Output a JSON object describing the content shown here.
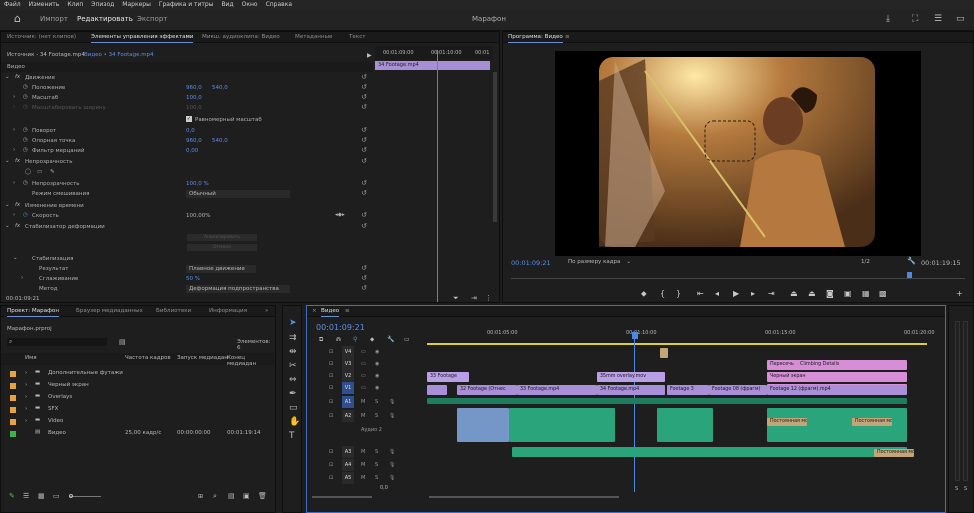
{
  "menu": [
    "Файл",
    "Изменить",
    "Клип",
    "Эпизод",
    "Маркеры",
    "Графика и титры",
    "Вид",
    "Окно",
    "Справка"
  ],
  "header": {
    "title": "Марафон",
    "import": "Импорт",
    "edit": "Редактировать",
    "export": "Экспорт"
  },
  "effect_controls": {
    "tabs": [
      "Источник: (нет клипов)",
      "Элементы управления эффектами",
      "Микш. аудиоклипа: Видео",
      "Метаданные",
      "Текст"
    ],
    "source": "Источник - 34 Footage.mp4",
    "sequence": "Видео • 34 Footage.mp4",
    "ruler": [
      "00:01:09:00",
      "00:01:10:00",
      "00:01"
    ],
    "clip_label": "34 Footage.mp4",
    "video_header": "Видео",
    "motion": "Движение",
    "position": "Положение",
    "position_x": "960,0",
    "position_y": "540,0",
    "scale": "Масштаб",
    "scale_v": "100,0",
    "scale_w": "Масштабировать ширину",
    "scale_w_v": "100,0",
    "uniform": "Равномерный масштаб",
    "rotation": "Поворот",
    "rotation_v": "0,0",
    "anchor": "Опорная точка",
    "anchor_x": "960,0",
    "anchor_y": "540,0",
    "flicker": "Фильтр мерцаний",
    "flicker_v": "0,00",
    "opacity": "Непрозрачность",
    "opacity_prop": "Непрозрачность",
    "opacity_v": "100,0 %",
    "blend": "Режим смешивания",
    "blend_v": "Обычный",
    "time_remap": "Изменение времени",
    "speed": "Скорость",
    "speed_v": "100,00%",
    "stabilizer": "Стабилизатор деформации",
    "btn1": "Анализировать",
    "btn2": "Отмена",
    "stabilization": "Стабилизация",
    "result": "Результат",
    "result_v": "Плавное движение",
    "smooth": "Сглаживание",
    "smooth_v": "50 %",
    "method": "Метод",
    "method_v": "Деформация подпространства",
    "timecode": "00:01:09:21"
  },
  "program": {
    "title": "Программа: Видео",
    "timecode": "00:01:09:21",
    "fit": "По размеру кадра",
    "ratio": "1/2",
    "duration": "00:01:19:15"
  },
  "project": {
    "tabs": [
      "Проект: Марафон",
      "Браузер медиаданных",
      "Библиотеки",
      "Информация"
    ],
    "file": "Марафон.prproj",
    "count": "Элементов: 6",
    "columns": [
      "Имя",
      "Частота кадров",
      "Запуск медиадан",
      "Конец медиадан"
    ],
    "items": [
      {
        "name": "Дополнительные футажи",
        "color": "#e8a23c",
        "fr": "",
        "start": "",
        "end": ""
      },
      {
        "name": "Черный экран",
        "color": "#e8a23c",
        "fr": "",
        "start": "",
        "end": ""
      },
      {
        "name": "Overlays",
        "color": "#e8a23c",
        "fr": "",
        "start": "",
        "end": ""
      },
      {
        "name": "SFX",
        "color": "#e8a23c",
        "fr": "",
        "start": "",
        "end": ""
      },
      {
        "name": "Video",
        "color": "#e8a23c",
        "fr": "",
        "start": "",
        "end": ""
      },
      {
        "name": "Видео",
        "color": "#3fb24a",
        "fr": "25,00 кадр/с",
        "start": "00:00:00:00",
        "end": "00:01:19:14"
      }
    ]
  },
  "timeline": {
    "tab": "Видео",
    "timecode": "00:01:09:21",
    "ruler": [
      "00:01:05:00",
      "00:01:10:00",
      "00:01:15:00",
      "00:01:20:00"
    ],
    "tracks": [
      "V4",
      "V3",
      "V2",
      "V1",
      "A1",
      "A2",
      "A3",
      "A4",
      "A5"
    ],
    "audio2_label": "Аудио 2",
    "zero": "0,0",
    "meter": [
      "S",
      "S"
    ],
    "clips": {
      "v3_a": "Пересечь",
      "v3_b": "Climbing Details",
      "v2_a": "33 Footage",
      "v2_b": "35mm overlay.mov",
      "v2_c": "Черный экран",
      "v2_d": "Черный экран",
      "v1_a": "32 Footage (Отнес",
      "v1_b": "33 Footage.mp4",
      "v1_c": "34 Footage.mp4",
      "v1_d": "Footage 3",
      "v1_e": "Footage 08 (фрагм)",
      "v1_f": "Footage 12 (фрагм).mp4",
      "a3_a": "Постоянная мощн",
      "a3_b": "Постоянная мощн",
      "a3_c": "Постоянная мощн"
    }
  }
}
